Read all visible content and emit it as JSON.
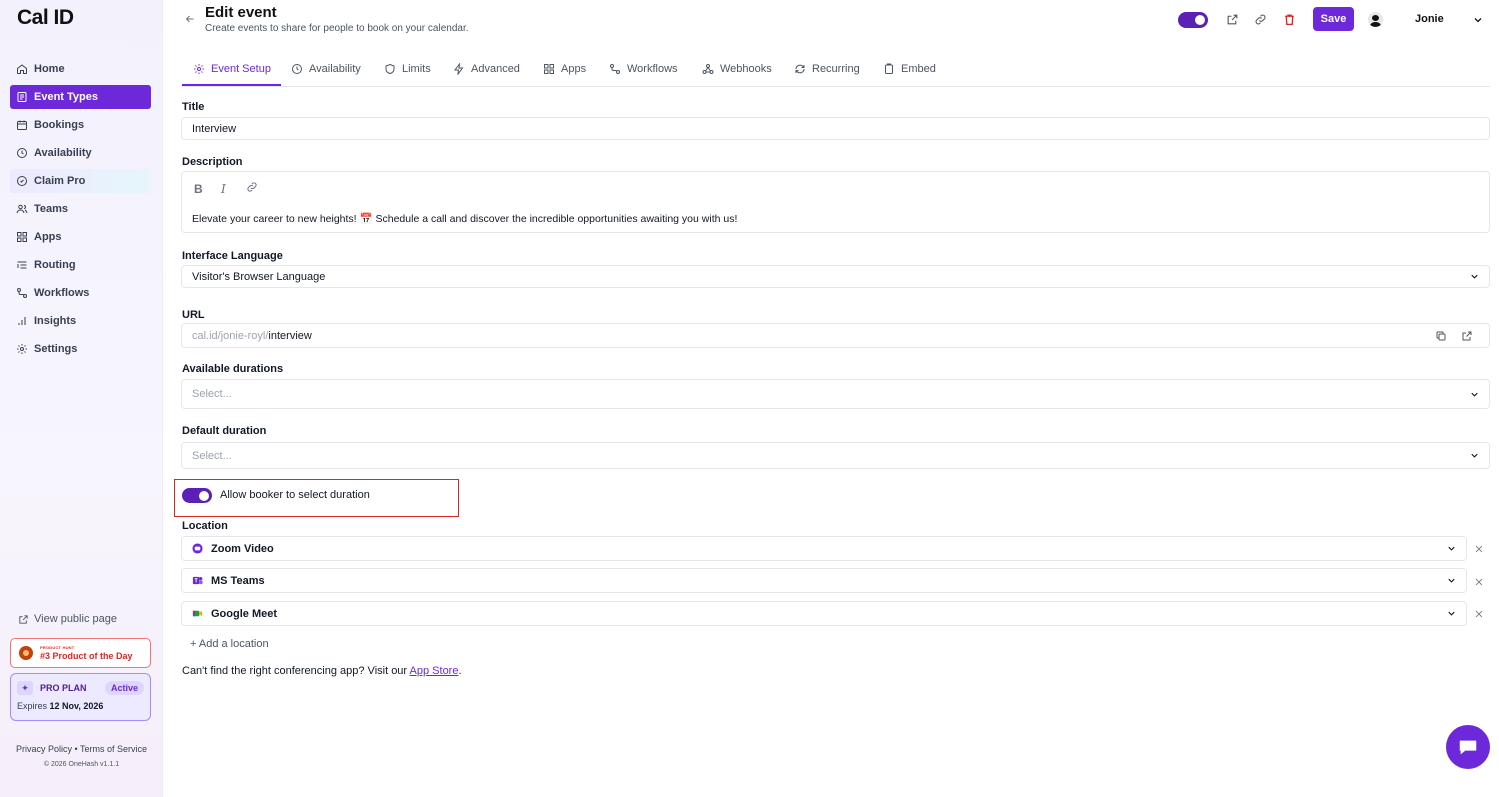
{
  "sidebar": {
    "logo": "Cal ID",
    "items": [
      {
        "label": "Home",
        "icon": "home-icon"
      },
      {
        "label": "Event Types",
        "icon": "event-types-icon"
      },
      {
        "label": "Bookings",
        "icon": "calendar-icon"
      },
      {
        "label": "Availability",
        "icon": "clock-icon"
      },
      {
        "label": "Claim Pro",
        "icon": "badge-icon"
      },
      {
        "label": "Teams",
        "icon": "users-icon"
      },
      {
        "label": "Apps",
        "icon": "grid-icon"
      },
      {
        "label": "Routing",
        "icon": "routing-icon"
      },
      {
        "label": "Workflows",
        "icon": "workflow-icon"
      },
      {
        "label": "Insights",
        "icon": "bar-chart-icon"
      },
      {
        "label": "Settings",
        "icon": "gear-icon"
      }
    ],
    "view_public_page": "View public page",
    "product_hunt": {
      "small": "PRODUCT HUNT",
      "big": "#3 Product of the Day"
    },
    "pro_plan": {
      "name": "PRO PLAN",
      "status": "Active",
      "expires_label": "Expires",
      "expires_date": "12 Nov, 2026"
    },
    "footer": {
      "privacy": "Privacy Policy",
      "separator": "•",
      "terms": "Terms of Service",
      "copyright": "© 2026 OneHash v1.1.1"
    }
  },
  "header": {
    "title": "Edit event",
    "subtitle": "Create events to share for people to book on your calendar.",
    "save_label": "Save",
    "user_name": "Jonie",
    "hidden_toggle_on": true
  },
  "tabs": [
    {
      "label": "Event Setup",
      "icon": "gear-icon",
      "active": true
    },
    {
      "label": "Availability",
      "icon": "clock-icon"
    },
    {
      "label": "Limits",
      "icon": "shield-icon"
    },
    {
      "label": "Advanced",
      "icon": "zap-icon"
    },
    {
      "label": "Apps",
      "icon": "grid-icon"
    },
    {
      "label": "Workflows",
      "icon": "workflow-icon"
    },
    {
      "label": "Webhooks",
      "icon": "webhook-icon"
    },
    {
      "label": "Recurring",
      "icon": "repeat-icon"
    },
    {
      "label": "Embed",
      "icon": "clipboard-icon"
    }
  ],
  "form": {
    "title_label": "Title",
    "title_value": "Interview",
    "description_label": "Description",
    "description_value": "Elevate your career to new heights! 📅 Schedule a call and discover the incredible opportunities awaiting you with us!",
    "format": {
      "bold": "B",
      "italic": "I"
    },
    "language_label": "Interface Language",
    "language_value": "Visitor's Browser Language",
    "url_label": "URL",
    "url_prefix": "cal.id/jonie-royl/",
    "url_slug": "interview",
    "durations_label": "Available durations",
    "durations_placeholder": "Select...",
    "default_duration_label": "Default duration",
    "default_duration_placeholder": "Select...",
    "allow_duration_label": "Allow booker to select duration",
    "allow_duration_on": true,
    "location_label": "Location",
    "locations": [
      {
        "name": "Zoom Video",
        "icon": "zoom-icon",
        "color": "#6d28d9"
      },
      {
        "name": "MS Teams",
        "icon": "ms-teams-icon",
        "color": "#6d28d9"
      },
      {
        "name": "Google Meet",
        "icon": "google-meet-icon",
        "color": "#16a34a"
      }
    ],
    "add_location": "+ Add a location",
    "cant_find_text": "Can't find the right conferencing app? Visit our",
    "app_store_link": "App Store",
    "cant_find_suffix": "."
  },
  "colors": {
    "accent": "#6d28d9",
    "highlight": "#dc2626",
    "danger": "#dc2626"
  }
}
